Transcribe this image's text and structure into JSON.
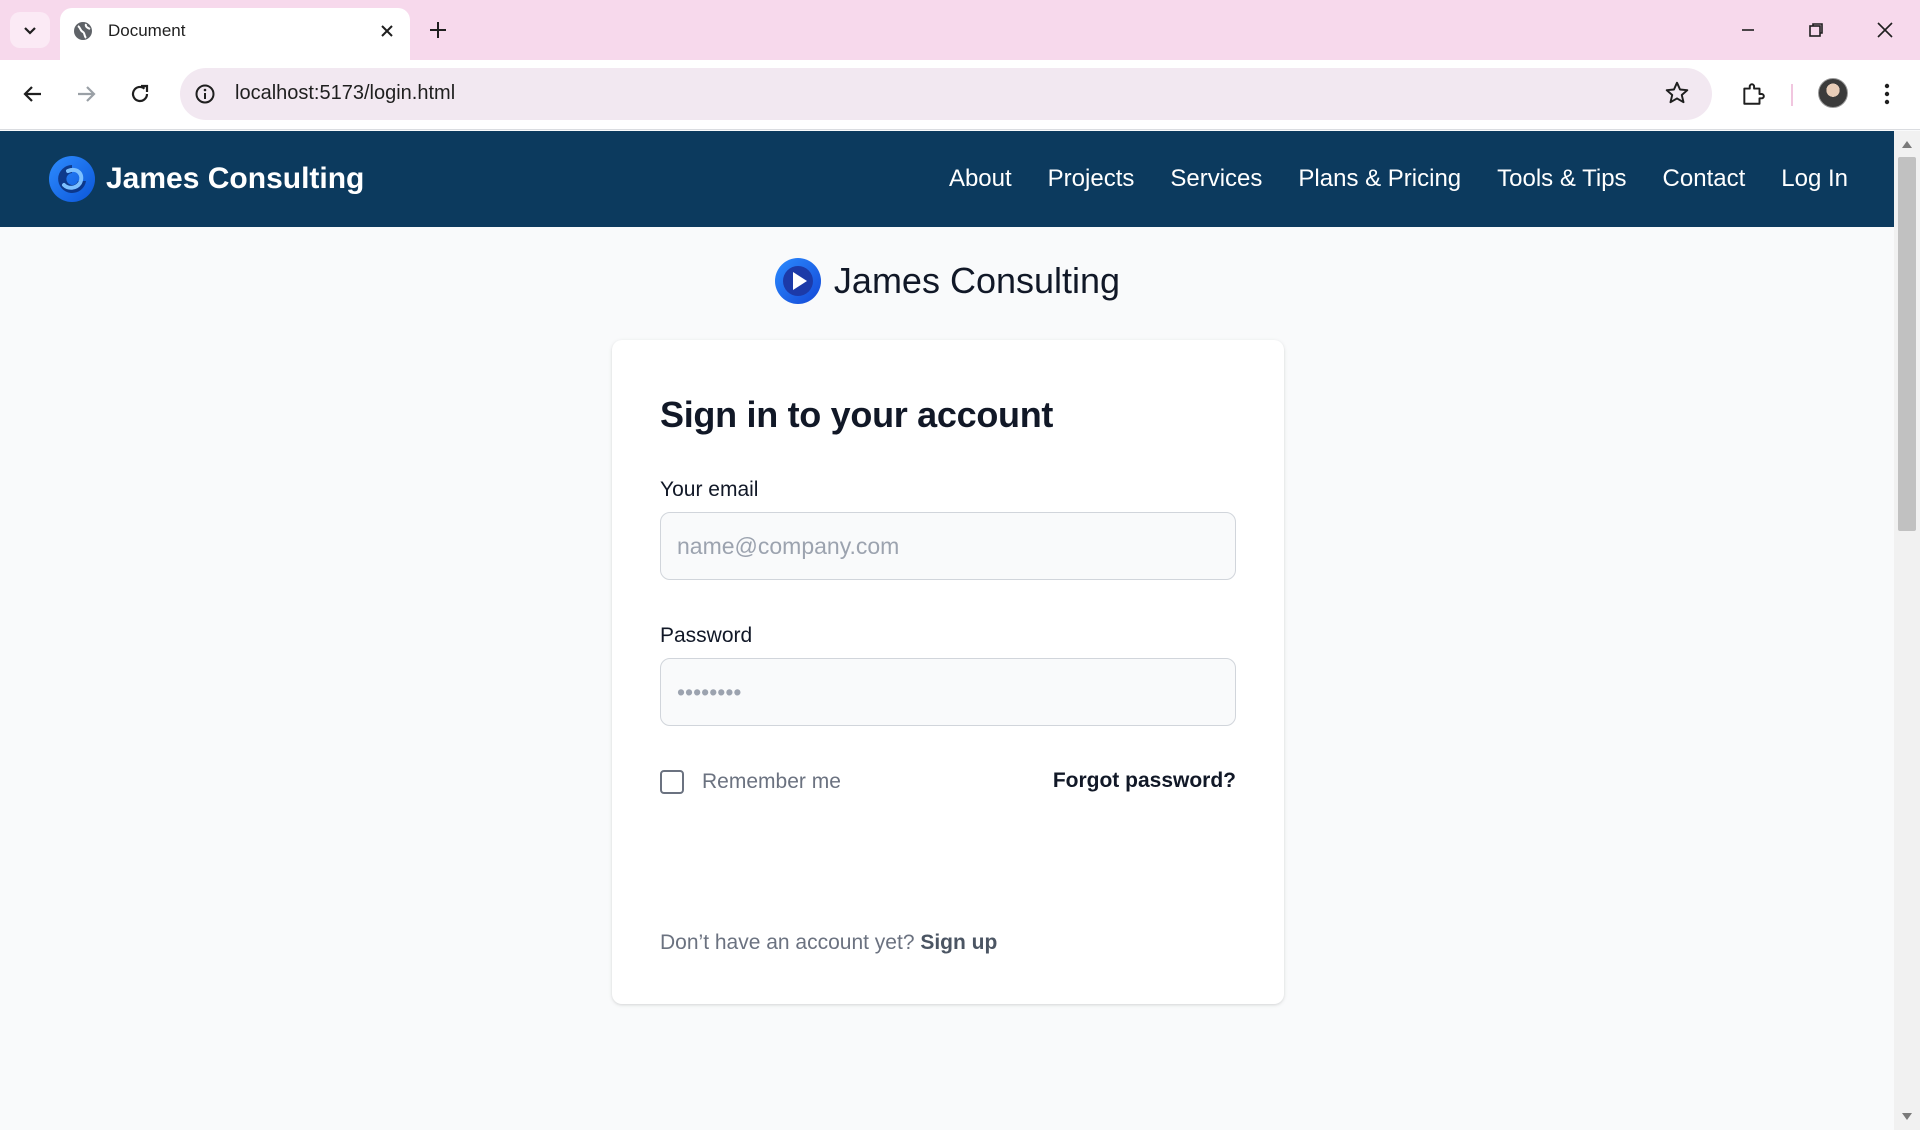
{
  "browser": {
    "tab_title": "Document",
    "url": "localhost:5173/login.html",
    "icons": {
      "tab_list": "chevron-down-icon",
      "tab_favicon": "globe-icon",
      "tab_close": "close-icon",
      "new_tab": "plus-icon",
      "back": "arrow-left-icon",
      "forward": "arrow-right-icon",
      "reload": "reload-icon",
      "site_info": "info-icon",
      "bookmark": "star-icon",
      "extensions": "puzzle-icon",
      "menu": "kebab-menu-icon"
    }
  },
  "site": {
    "brand_name": "James Consulting",
    "nav": {
      "about": "About",
      "projects": "Projects",
      "services": "Services",
      "plans": "Plans & Pricing",
      "tools": "Tools & Tips",
      "contact": "Contact",
      "login": "Log In"
    },
    "colors": {
      "nav_background": "#0c3a5e",
      "logo_blue": "#1d6ff2"
    }
  },
  "login": {
    "brand_name": "James Consulting",
    "heading": "Sign in to your account",
    "email_label": "Your email",
    "email_placeholder": "name@company.com",
    "password_label": "Password",
    "password_placeholder": "••••••••",
    "remember_label": "Remember me",
    "remember_checked": false,
    "forgot_link": "Forgot password?",
    "signup_prompt": "Don’t have an account yet?",
    "signup_link": "Sign up"
  }
}
